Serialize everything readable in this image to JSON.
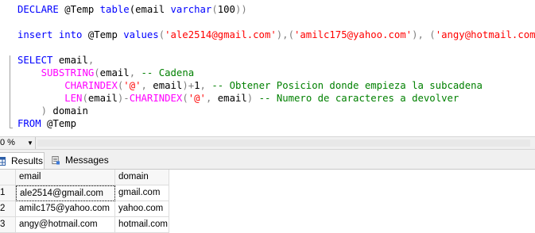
{
  "editor": {
    "lines": [
      [
        {
          "t": "DECLARE",
          "c": "kw"
        },
        {
          "t": " @Temp ",
          "c": "pl"
        },
        {
          "t": "table",
          "c": "kw"
        },
        {
          "t": "(email ",
          "c": "pl"
        },
        {
          "t": "varchar",
          "c": "kw"
        },
        {
          "t": "(",
          "c": "gr"
        },
        {
          "t": "100",
          "c": "pl"
        },
        {
          "t": "))",
          "c": "gr"
        }
      ],
      [],
      [
        {
          "t": "insert into",
          "c": "kw"
        },
        {
          "t": " @Temp ",
          "c": "pl"
        },
        {
          "t": "values",
          "c": "kw"
        },
        {
          "t": "(",
          "c": "gr"
        },
        {
          "t": "'ale2514@gmail.com'",
          "c": "str"
        },
        {
          "t": "),(",
          "c": "gr"
        },
        {
          "t": "'amilc175@yahoo.com'",
          "c": "str"
        },
        {
          "t": "), (",
          "c": "gr"
        },
        {
          "t": "'angy@hotmail.com'",
          "c": "str"
        },
        {
          "t": ")",
          "c": "gr"
        }
      ],
      [],
      [
        {
          "t": "SELECT",
          "c": "kw"
        },
        {
          "t": " email",
          "c": "pl"
        },
        {
          "t": ",",
          "c": "gr"
        }
      ],
      [
        {
          "t": "    ",
          "c": "pl"
        },
        {
          "t": "SUBSTRING",
          "c": "fn"
        },
        {
          "t": "(",
          "c": "gr"
        },
        {
          "t": "email",
          "c": "pl"
        },
        {
          "t": ",",
          "c": "gr"
        },
        {
          "t": " -- Cadena",
          "c": "cm"
        }
      ],
      [
        {
          "t": "        ",
          "c": "pl"
        },
        {
          "t": "CHARINDEX",
          "c": "fn"
        },
        {
          "t": "(",
          "c": "gr"
        },
        {
          "t": "'@'",
          "c": "str"
        },
        {
          "t": ",",
          "c": "gr"
        },
        {
          "t": " email",
          "c": "pl"
        },
        {
          "t": ")+",
          "c": "gr"
        },
        {
          "t": "1",
          "c": "pl"
        },
        {
          "t": ",",
          "c": "gr"
        },
        {
          "t": " -- Obtener Posicion donde empieza la subcadena",
          "c": "cm"
        }
      ],
      [
        {
          "t": "        ",
          "c": "pl"
        },
        {
          "t": "LEN",
          "c": "fn"
        },
        {
          "t": "(",
          "c": "gr"
        },
        {
          "t": "email",
          "c": "pl"
        },
        {
          "t": ")-",
          "c": "gr"
        },
        {
          "t": "CHARINDEX",
          "c": "fn"
        },
        {
          "t": "(",
          "c": "gr"
        },
        {
          "t": "'@'",
          "c": "str"
        },
        {
          "t": ",",
          "c": "gr"
        },
        {
          "t": " email",
          "c": "pl"
        },
        {
          "t": ")",
          "c": "gr"
        },
        {
          "t": " -- Numero de caracteres a devolver",
          "c": "cm"
        }
      ],
      [
        {
          "t": "    ",
          "c": "pl"
        },
        {
          "t": ")",
          "c": "gr"
        },
        {
          "t": " domain",
          "c": "pl"
        }
      ],
      [
        {
          "t": "FROM",
          "c": "kw"
        },
        {
          "t": " @Temp",
          "c": "pl"
        }
      ]
    ]
  },
  "status": {
    "zoom": "0 %",
    "zoom_arrow": "▼"
  },
  "tabs": {
    "results_label": "Results",
    "messages_label": "Messages"
  },
  "grid": {
    "columns": [
      "email",
      "domain"
    ],
    "rows": [
      {
        "num": "1",
        "email": "ale2514@gmail.com",
        "domain": "gmail.com"
      },
      {
        "num": "2",
        "email": "amilc175@yahoo.com",
        "domain": "yahoo.com"
      },
      {
        "num": "3",
        "email": "angy@hotmail.com",
        "domain": "hotmail.com"
      }
    ]
  },
  "colors": {
    "keyword": "#0000ff",
    "function": "#ff00ff",
    "string": "#ff0000",
    "comment": "#008000",
    "operator": "#808080"
  }
}
